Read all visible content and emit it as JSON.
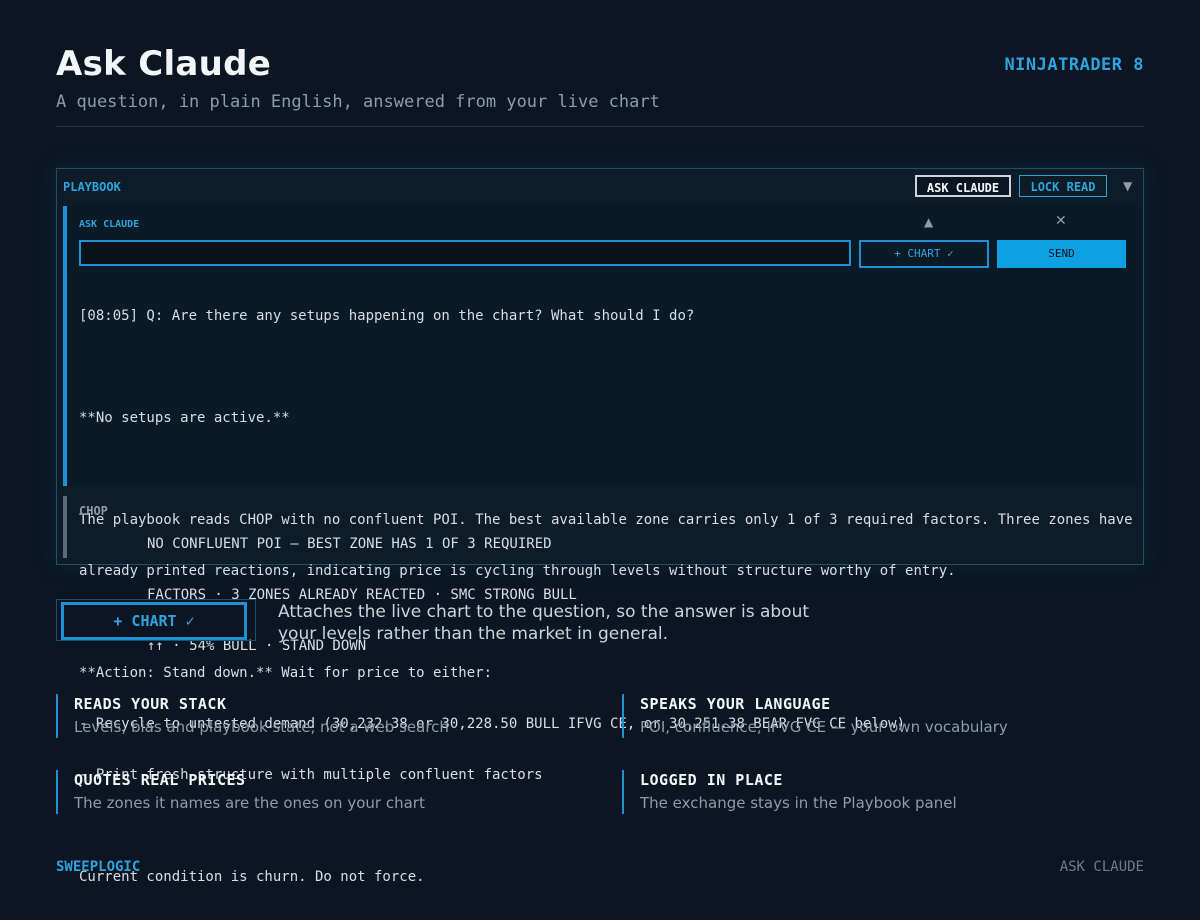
{
  "header": {
    "title": "Ask Claude",
    "subtitle": "A question, in plain English, answered from your live chart",
    "platform": "NINJATRADER 8"
  },
  "panel": {
    "title": "PLAYBOOK",
    "ask_button": "ASK CLAUDE",
    "lock_button": "LOCK READ",
    "collapse_icon": "▼",
    "ask_label": "ASK CLAUDE",
    "up_icon": "▲",
    "close_icon": "✕",
    "input_value": "",
    "chart_button": "+ CHART ✓",
    "send_button": "SEND",
    "transcript": [
      "[08:05] Q: Are there any setups happening on the chart? What should I do?",
      "",
      "**No setups are active.**",
      "",
      "The playbook reads CHOP with no confluent POI. The best available zone carries only 1 of 3 required factors. Three zones have",
      "already printed reactions, indicating price is cycling through levels without structure worthy of entry.",
      "",
      "**Action: Stand down.** Wait for price to either:",
      "- Recycle to untested demand (30,232.38 or 30,228.50 BULL IFVG CE, or 30,251.38 BEAR FVG CE below)",
      "- Print fresh structure with multiple confluent factors",
      "",
      "Current condition is churn. Do not force."
    ],
    "status_tag": "CHOP",
    "status_lines": [
      "NO CONFLUENT POI — BEST ZONE HAS 1 OF 3 REQUIRED",
      "FACTORS · 3 ZONES ALREADY REACTED · SMC STRONG BULL",
      "↑↑ · 54% BULL · STAND DOWN"
    ]
  },
  "chart_feature": {
    "button": "+ CHART ✓",
    "description": "Attaches the live chart to the question, so the answer is about your levels rather than the market in general."
  },
  "features": [
    {
      "title": "READS YOUR STACK",
      "desc": "Levels, bias and playbook state, not a web search"
    },
    {
      "title": "SPEAKS YOUR LANGUAGE",
      "desc": "POI, confluence, IFVG CE — your own vocabulary"
    },
    {
      "title": "QUOTES REAL PRICES",
      "desc": "The zones it names are the ones on your chart"
    },
    {
      "title": "LOGGED IN PLACE",
      "desc": "The exchange stays in the Playbook panel"
    }
  ],
  "footer": {
    "brand": "SWEEPLOGIC",
    "label": "ASK CLAUDE"
  }
}
